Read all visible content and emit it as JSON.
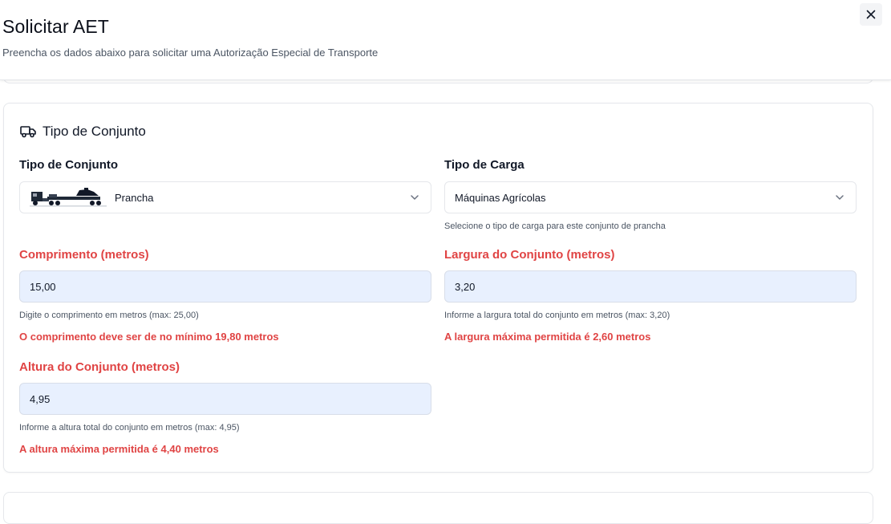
{
  "dialog": {
    "title": "Solicitar AET",
    "subtitle": "Preencha os dados abaixo para solicitar uma Autorização Especial de Transporte",
    "close_icon": "close-icon"
  },
  "section": {
    "title": "Tipo de Conjunto",
    "icon": "truck-icon",
    "tipo_conjunto": {
      "label": "Tipo de Conjunto",
      "value": "Prancha",
      "icon": "lowboy-truck-image"
    },
    "tipo_carga": {
      "label": "Tipo de Carga",
      "value": "Máquinas Agrícolas",
      "hint": "Selecione o tipo de carga para este conjunto de prancha"
    },
    "comprimento": {
      "label": "Comprimento (metros)",
      "value": "15,00",
      "hint": "Digite o comprimento em metros (max: 25,00)",
      "error": "O comprimento deve ser de no mínimo 19,80 metros"
    },
    "largura": {
      "label": "Largura do Conjunto (metros)",
      "value": "3,20",
      "hint": "Informe a largura total do conjunto em metros (max: 3,20)",
      "error": "A largura máxima permitida é 2,60 metros"
    },
    "altura": {
      "label": "Altura do Conjunto (metros)",
      "value": "4,95",
      "hint": "Informe a altura total do conjunto em metros (max: 4,95)",
      "error": "A altura máxima permitida é 4,40 metros"
    }
  },
  "colors": {
    "error": "#e04444",
    "input_bg": "#e8f0fe",
    "border": "#e5e7eb"
  }
}
